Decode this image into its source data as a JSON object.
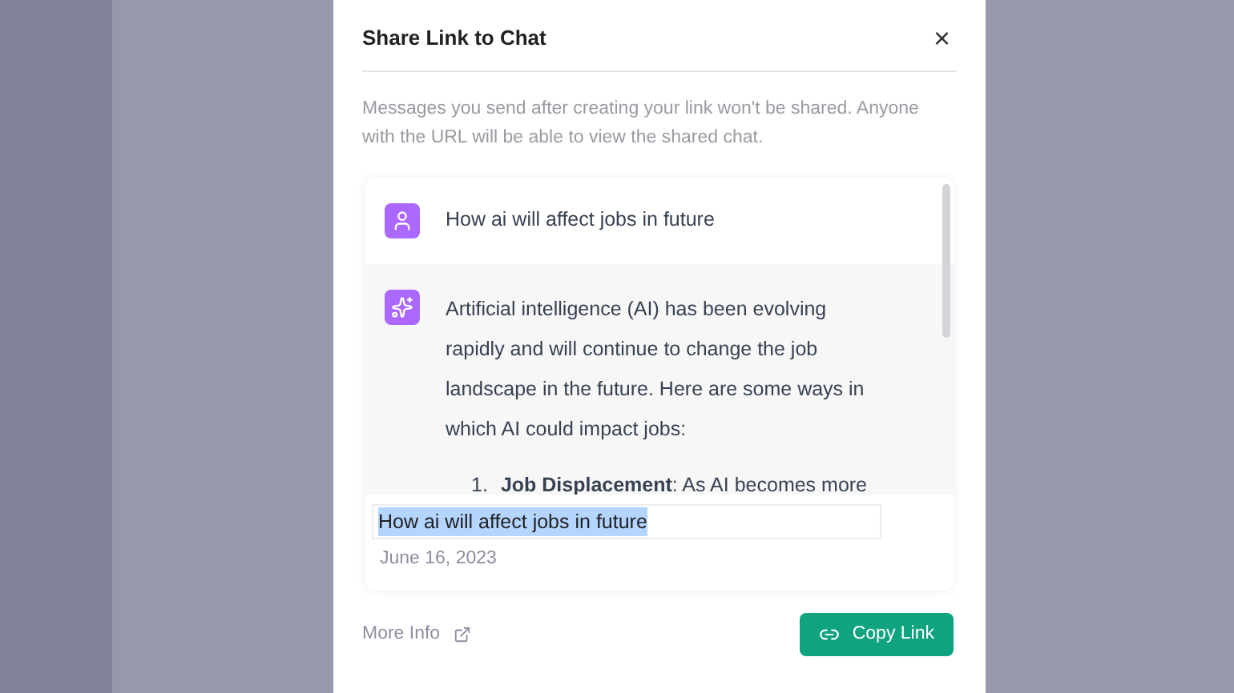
{
  "dialog": {
    "title": "Share Link to Chat",
    "close": "×",
    "description": "Messages you send after creating your link won't be shared. Anyone with the URL will be able to view the shared chat."
  },
  "preview": {
    "messages": [
      {
        "kind": "user",
        "text": "How ai will affect jobs in future"
      },
      {
        "kind": "assistant",
        "text": "Artificial intelligence (AI) has been evolving rapidly and will continue to change the job landscape in the future. Here are some ways in which AI could impact jobs:",
        "list": [
          {
            "number": "1.",
            "text": "**Job Displacement**: As AI becomes more"
          }
        ]
      }
    ],
    "chat_title": {
      "value": "How ai will affect jobs in future",
      "text_selected": true
    },
    "date": "June 16, 2023"
  },
  "footer": {
    "more_info": "More Info",
    "copy_button": "Copy Link"
  }
}
